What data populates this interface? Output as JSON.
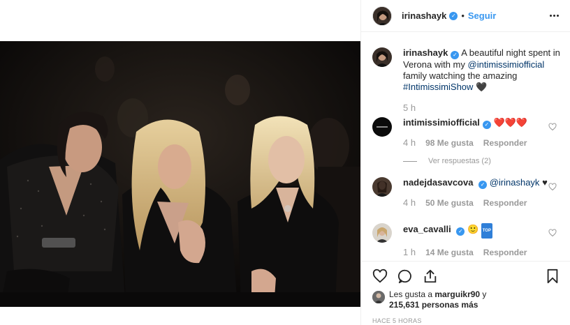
{
  "post": {
    "author": "irinashayk",
    "follow_label": "Seguir",
    "separator": "•",
    "caption_prefix": "A beautiful night spent in Verona with my ",
    "caption_mention": "@intimissimiofficial",
    "caption_mid": " family watching the amazing ",
    "caption_hashtag": "#IntimissimiShow",
    "caption_emoji": "🖤",
    "caption_time": "5 h"
  },
  "comments": [
    {
      "user": "intimissimiofficial",
      "text": "❤️❤️❤️",
      "time": "4 h",
      "likes": "98 Me gusta",
      "reply": "Responder",
      "view_replies": "Ver respuestas (2)"
    },
    {
      "user": "nadejdasavcova",
      "mention": "@irinashayk",
      "text": "♥",
      "time": "4 h",
      "likes": "50 Me gusta",
      "reply": "Responder"
    },
    {
      "user": "eva_cavalli",
      "text": "🙂",
      "badge": "TOP",
      "time": "1 h",
      "likes": "14 Me gusta",
      "reply": "Responder"
    }
  ],
  "footer": {
    "likes_prefix": "Les gusta a ",
    "likes_user": "marguikr90",
    "likes_mid": " y",
    "likes_count": "215,631 personas más",
    "posted_ago": "HACE 5 HORAS"
  },
  "icons": {
    "like": "heart-outline-icon",
    "comment": "comment-bubble-icon",
    "share": "share-icon",
    "save": "bookmark-icon",
    "more": "more-options-icon",
    "verified": "verified-badge-icon"
  },
  "colors": {
    "link_blue": "#3897f0",
    "mention": "#003569",
    "muted": "#999999",
    "text": "#262626",
    "heart_red": "#ed4956"
  }
}
